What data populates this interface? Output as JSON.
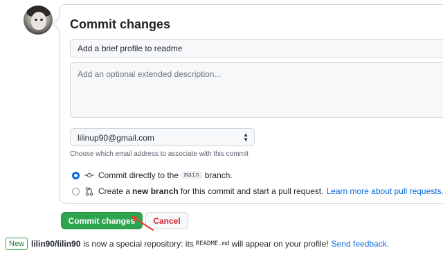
{
  "commit_form": {
    "title": "Commit changes",
    "summary_value": "Add a brief profile to readme",
    "description_placeholder": "Add an optional extended description...",
    "email_selected": "lilinup90@gmail.com",
    "email_hint": "Choose which email address to associate with this commit",
    "option_direct": {
      "text_before": "Commit directly to the",
      "branch": "main",
      "text_after": "branch.",
      "checked": true
    },
    "option_new_branch": {
      "text_before": "Create a",
      "bold": "new branch",
      "text_after": "for this commit and start a pull request.",
      "link": "Learn more about pull requests.",
      "checked": false
    },
    "commit_button": "Commit changes",
    "cancel_button": "Cancel"
  },
  "footer": {
    "badge": "New",
    "repo": "lilin90/lilin90",
    "text_before": "is now a special repository: its",
    "file": "README.md",
    "text_after": "will appear on your profile!",
    "link": "Send feedback",
    "end": "."
  },
  "colors": {
    "primary_button": "#2da44e",
    "cancel_text": "#cf222e",
    "link": "#0969da",
    "annotation_arrow": "#e8412c"
  },
  "icons": [
    "avatar",
    "git-commit-icon",
    "git-pull-request-icon",
    "select-arrows-icon"
  ]
}
